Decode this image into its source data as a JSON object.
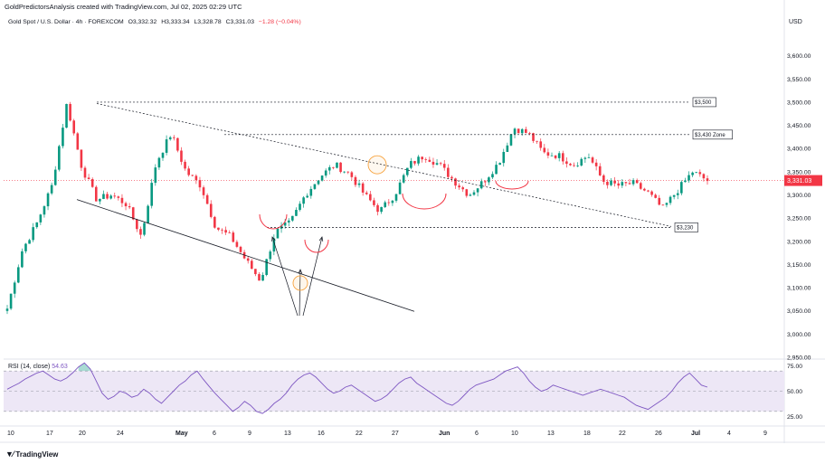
{
  "header": {
    "credit": "GoldPredictorsAnalysis created with TradingView.com, Jul 02, 2025 02:29 UTC"
  },
  "legend": {
    "symbol": "Gold Spot / U.S. Dollar · 4h · FOREXCOM",
    "open": "O3,332.32",
    "high": "H3,333.34",
    "low": "L3,328.78",
    "close": "C3,331.03",
    "change": "−1.28 (−0.04%)"
  },
  "price_axis": {
    "currency": "USD"
  },
  "rsi": {
    "label": "RSI (14, close)",
    "value": "54.63"
  },
  "footer": {
    "brand": "TradingView"
  },
  "colors": {
    "up": "#089981",
    "down": "#f23645",
    "rsi_line": "#7e57c2",
    "rsi_band": "#ede7f6",
    "highlight_circle": "#f7a23c",
    "current_price_badge": "#f23645"
  },
  "chart_data": [
    {
      "type": "candlestick",
      "title": "Gold Spot / U.S. Dollar · 4h · FOREXCOM",
      "ylabel": "USD",
      "ylim": [
        2950,
        3650
      ],
      "y_ticks": [
        "3,600.00",
        "3,550.00",
        "3,500.00",
        "3,450.00",
        "3,400.00",
        "3,350.00",
        "3,300.00",
        "3,250.00",
        "3,200.00",
        "3,150.00",
        "3,100.00",
        "3,050.00",
        "3,000.00",
        "2,950.00"
      ],
      "x_ticks": [
        "10",
        "13",
        "17",
        "20",
        "24",
        "May",
        "6",
        "9",
        "13",
        "16",
        "20",
        "22",
        "27",
        "Jun",
        "6",
        "10",
        "13",
        "18",
        "22",
        "26",
        "Jul",
        "4",
        "9"
      ],
      "current_price": "3,331.03",
      "price_path": [
        [
          "10",
          3055
        ],
        [
          "13",
          3180
        ],
        [
          "17",
          3240
        ],
        [
          "20",
          3320
        ],
        [
          "22",
          3497
        ],
        [
          "23",
          3360
        ],
        [
          "24",
          3290
        ],
        [
          "28",
          3300
        ],
        [
          "30",
          3280
        ],
        [
          "May",
          3210
        ],
        [
          "6",
          3370
        ],
        [
          "7",
          3432
        ],
        [
          "8",
          3350
        ],
        [
          "9",
          3320
        ],
        [
          "11",
          3230
        ],
        [
          "13",
          3210
        ],
        [
          "14",
          3160
        ],
        [
          "15",
          3115
        ],
        [
          "16",
          3220
        ],
        [
          "19",
          3240
        ],
        [
          "20",
          3300
        ],
        [
          "22",
          3340
        ],
        [
          "23",
          3365
        ],
        [
          "25",
          3345
        ],
        [
          "27",
          3300
        ],
        [
          "28",
          3265
        ],
        [
          "29",
          3300
        ],
        [
          "Jun",
          3365
        ],
        [
          "4",
          3385
        ],
        [
          "5",
          3365
        ],
        [
          "6",
          3330
        ],
        [
          "9",
          3300
        ],
        [
          "11",
          3330
        ],
        [
          "12",
          3370
        ],
        [
          "13",
          3445
        ],
        [
          "14",
          3432
        ],
        [
          "16",
          3390
        ],
        [
          "18",
          3385
        ],
        [
          "20",
          3365
        ],
        [
          "22",
          3385
        ],
        [
          "23",
          3330
        ],
        [
          "24",
          3320
        ],
        [
          "25",
          3325
        ],
        [
          "26",
          3305
        ],
        [
          "27",
          3270
        ],
        [
          "30",
          3310
        ],
        [
          "Jul",
          3350
        ],
        [
          "1",
          3331
        ]
      ],
      "annotations": [
        "$3,500",
        "$3,430 Zone",
        "$3,230"
      ],
      "annotation_levels": [
        3500,
        3430,
        3230
      ]
    },
    {
      "type": "line",
      "title": "RSI (14, close)",
      "ylim": [
        20,
        80
      ],
      "y_ticks": [
        "75.00",
        "50.00",
        "25.00"
      ],
      "levels": [
        70,
        50,
        30
      ],
      "series": [
        {
          "name": "RSI (14, close)",
          "values": [
            52,
            55,
            58,
            62,
            65,
            68,
            70,
            66,
            62,
            60,
            63,
            68,
            74,
            78,
            72,
            60,
            48,
            42,
            45,
            50,
            48,
            44,
            46,
            52,
            48,
            42,
            38,
            44,
            50,
            56,
            60,
            66,
            70,
            62,
            55,
            48,
            42,
            36,
            30,
            34,
            40,
            36,
            30,
            28,
            32,
            38,
            42,
            48,
            56,
            62,
            66,
            68,
            64,
            58,
            52,
            48,
            50,
            54,
            56,
            52,
            48,
            44,
            40,
            42,
            46,
            52,
            58,
            62,
            64,
            58,
            54,
            50,
            46,
            42,
            38,
            36,
            40,
            46,
            52,
            56,
            58,
            60,
            62,
            66,
            70,
            72,
            74,
            68,
            60,
            54,
            50,
            52,
            56,
            54,
            52,
            50,
            48,
            46,
            48,
            50,
            52,
            50,
            48,
            46,
            44,
            40,
            36,
            34,
            32,
            36,
            40,
            44,
            50,
            58,
            64,
            68,
            62,
            56,
            54
          ]
        }
      ]
    }
  ]
}
